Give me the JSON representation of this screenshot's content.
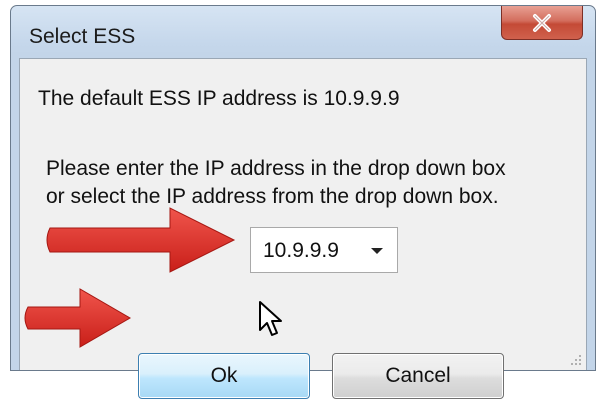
{
  "window": {
    "title": "Select ESS",
    "close_icon": "close-x-icon"
  },
  "dialog": {
    "default_text": "The default ESS IP address is 10.9.9.9",
    "instruction_line1": "Please enter the IP address in the drop down box",
    "instruction_line2": "or select the IP address from the drop down box."
  },
  "ip_select": {
    "value": "10.9.9.9"
  },
  "buttons": {
    "ok_label": "Ok",
    "cancel_label": "Cancel"
  },
  "annotations": {
    "arrow_color": "#e0332c"
  },
  "colors": {
    "close_button": "#c44a36",
    "ok_button_border": "#3c7fb1",
    "content_background": "#f0f0f0"
  }
}
